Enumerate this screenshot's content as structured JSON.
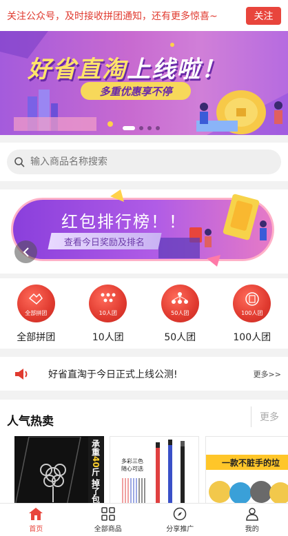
{
  "follow_bar": {
    "text": "关注公众号，及时接收拼团通知，还有更多惊喜~",
    "button": "关注"
  },
  "hero": {
    "title_part1": "好省直淘",
    "title_part2": "上线啦！",
    "subtitle": "多重优惠享不停",
    "slide_count": 4,
    "active_slide": 1
  },
  "search": {
    "placeholder": "输入商品名称搜索"
  },
  "rank_banner": {
    "title": "红包排行榜！！",
    "subtitle": "查看今日奖励及排名"
  },
  "categories": [
    {
      "label": "全部拼团",
      "icon_text": "全部拼团",
      "icon": "group-all-icon"
    },
    {
      "label": "10人团",
      "icon_text": "10人团",
      "icon": "group-10-icon"
    },
    {
      "label": "50人团",
      "icon_text": "50人团",
      "icon": "group-50-icon"
    },
    {
      "label": "100人团",
      "icon_text": "100人团",
      "icon": "group-100-icon"
    }
  ],
  "notice": {
    "text": "好省直淘于今日正式上线公测!",
    "more": "更多>>"
  },
  "hot_sale": {
    "title": "人气热卖",
    "more": "更多",
    "products": [
      {
        "tag_part1": "承重",
        "tag_highlight": "40",
        "tag_part2": "斤 掉了包"
      },
      {
        "line1": "多彩三色",
        "line2": "随心可选"
      },
      {
        "banner": "一款不脏手的垃"
      }
    ]
  },
  "tabbar": [
    {
      "label": "首页",
      "icon": "home-icon",
      "active": true
    },
    {
      "label": "全部商品",
      "icon": "grid-icon",
      "active": false
    },
    {
      "label": "分享推广",
      "icon": "compass-icon",
      "active": false
    },
    {
      "label": "我的",
      "icon": "user-icon",
      "active": false
    }
  ],
  "colors": {
    "accent": "#e8453c",
    "follow_text": "#e03a2f"
  }
}
